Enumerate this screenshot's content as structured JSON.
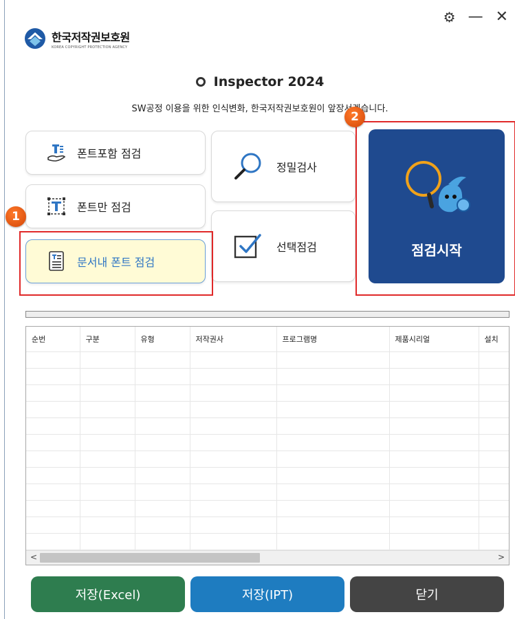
{
  "window": {
    "controls": {
      "settings": "⚙",
      "minimize": "—",
      "close": "✕"
    }
  },
  "logo": {
    "name_ko": "한국저작권보호원",
    "name_en": "KOREA COPYRIGHT PROTECTION AGENCY"
  },
  "app": {
    "title": "Inspector 2024",
    "tagline": "SW공정 이용을 위한 인식변화, 한국저작권보호원이 앞장서겠습니다."
  },
  "buttons": {
    "font_include": "폰트포함 점검",
    "font_only": "폰트만 점검",
    "doc_font": "문서내 폰트 점검",
    "precise": "정밀검사",
    "select": "선택점검",
    "start": "점검시작"
  },
  "badges": {
    "one": "1",
    "two": "2"
  },
  "progress": {
    "value": 0
  },
  "table": {
    "columns": [
      "순번",
      "구분",
      "유형",
      "저작권사",
      "프로그램명",
      "제품시리얼",
      "설치"
    ],
    "row_count": 12
  },
  "scrollbar": {
    "left": "<",
    "right": ">"
  },
  "footer": {
    "save_excel": "저장(Excel)",
    "save_ipt": "저장(IPT)",
    "close": "닫기"
  },
  "colors": {
    "accent_blue": "#1f4a8f",
    "highlight_red": "#e02828",
    "save_excel": "#2e7d4f",
    "save_ipt": "#1e7cc0",
    "close": "#444444"
  }
}
